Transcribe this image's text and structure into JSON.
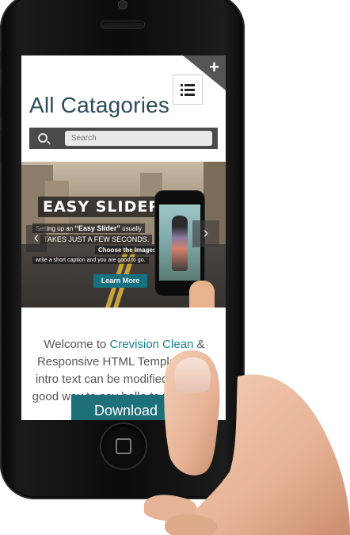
{
  "header": {
    "title": "All Catagories"
  },
  "search": {
    "placeholder": "Search"
  },
  "slider": {
    "title": "EASY SLIDER",
    "caption_line1_pre": "Setting up an",
    "caption_line1_em": "“Easy Slider”",
    "caption_line1_post": "usually",
    "caption_line2": "TAKES JUST A FEW SECONDS.",
    "caption_line3": "Choose the Images,",
    "caption_line4": "write a short caption and you are good to go.",
    "cta_label": "Learn More",
    "prev_icon": "‹",
    "next_icon": "›"
  },
  "intro": {
    "text_before_link": "Welcome to ",
    "link_text": "Crevision Clean",
    "text_after_link": " & Responsive HTML Template.This intro text can be modified and is a good way to say hello to the visitor."
  },
  "cta": {
    "download_label": "Download"
  },
  "icons": {
    "menu": "list-menu-icon",
    "search": "search-icon",
    "corner": "plus-icon",
    "home": "home-button-icon"
  },
  "colors": {
    "accent": "#1d6f7a",
    "title": "#2b4b5b",
    "searchbar": "#4a4a4a",
    "link": "#17808f"
  }
}
